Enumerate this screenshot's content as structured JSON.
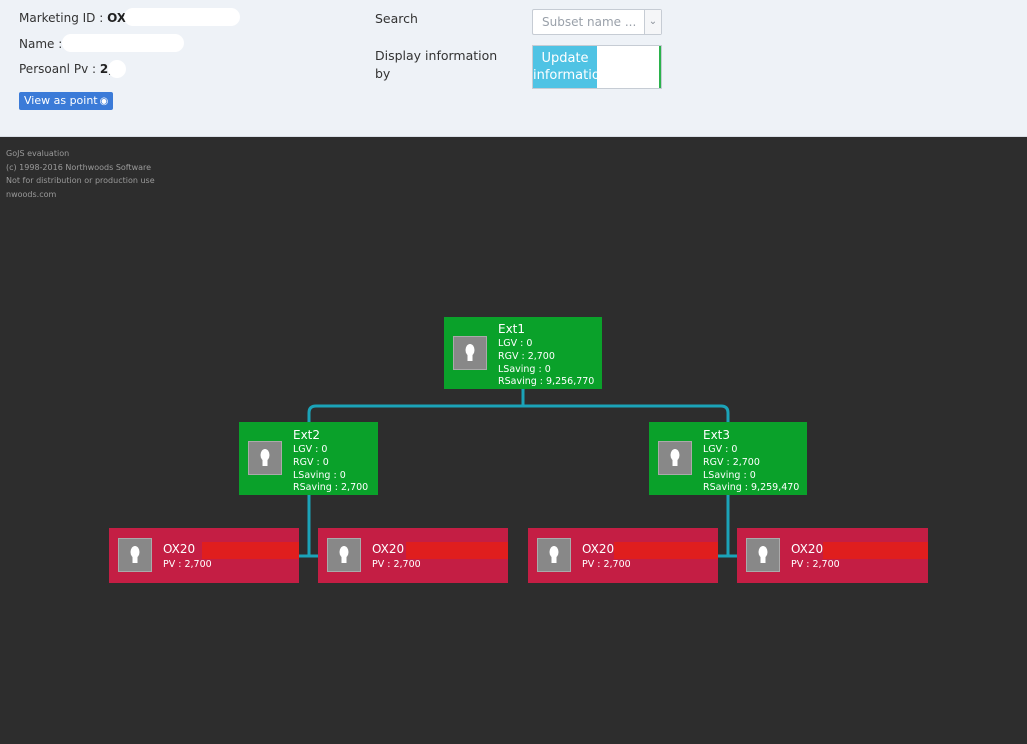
{
  "header": {
    "marketing_id_label": "Marketing ID : ",
    "marketing_id_value": "OX2",
    "name_label": "Name : ",
    "personal_pv_label": "Persoanl Pv : ",
    "personal_pv_value": "2,7",
    "view_as_point_label": "View as point",
    "search_label": "Search",
    "subset_placeholder": "Subset name ...",
    "display_info_label_1": "Display information",
    "display_info_label_2": "by",
    "update_label_1": "Update",
    "update_label_2": "informatio"
  },
  "watermark": [
    "GoJS evaluation",
    "(c) 1998-2016 Northwoods Software",
    "Not for distribution or production use",
    "nwoods.com"
  ],
  "tree": {
    "root": {
      "title": "Ext1",
      "lgv": "LGV : 0",
      "rgv": "RGV : 2,700",
      "lsaving": "LSaving : 0",
      "rsaving": "RSaving : 9,256,770"
    },
    "left": {
      "title": "Ext2",
      "lgv": "LGV : 0",
      "rgv": "RGV : 0",
      "lsaving": "LSaving : 0",
      "rsaving": "RSaving : 2,700"
    },
    "right": {
      "title": "Ext3",
      "lgv": "LGV : 0",
      "rgv": "RGV : 2,700",
      "lsaving": "LSaving : 0",
      "rsaving": "RSaving : 9,259,470"
    },
    "leaves": [
      {
        "title": "OX20",
        "pv": "PV : 2,700"
      },
      {
        "title": "OX20",
        "pv": "PV : 2,700"
      },
      {
        "title": "OX20",
        "pv": "PV : 2,700"
      },
      {
        "title": "OX20",
        "pv": "PV : 2,700"
      }
    ]
  },
  "colors": {
    "node_green": "#0aa12a",
    "node_red": "#c41e44",
    "link": "#1ba3b8",
    "canvas_bg": "#2d2d2d",
    "header_bg": "#eef2f7"
  },
  "icons": [
    "eye-icon",
    "chevron-down-icon",
    "avatar-icon"
  ]
}
